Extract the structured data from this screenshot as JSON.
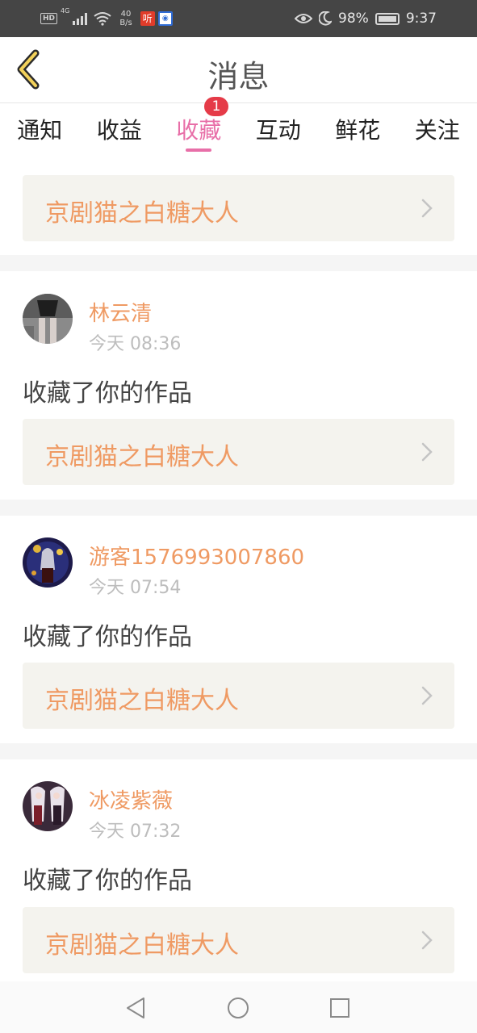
{
  "status_bar": {
    "hd": "HD",
    "net": "4G",
    "speed_value": "40",
    "speed_unit": "B/s",
    "app_ting": "听",
    "battery": "98%",
    "time": "9:37"
  },
  "header": {
    "title": "消息"
  },
  "tabs": [
    {
      "label": "通知"
    },
    {
      "label": "收益"
    },
    {
      "label": "收藏",
      "badge": "1"
    },
    {
      "label": "互动"
    },
    {
      "label": "鲜花"
    },
    {
      "label": "关注"
    }
  ],
  "top_work": {
    "title": "京剧猫之白糖大人"
  },
  "messages": [
    {
      "user": "林云清",
      "time": "今天 08:36",
      "text": "收藏了你的作品",
      "work": "京剧猫之白糖大人"
    },
    {
      "user": "游客1576993007860",
      "time": "今天 07:54",
      "text": "收藏了你的作品",
      "work": "京剧猫之白糖大人"
    },
    {
      "user": "冰凌紫薇",
      "time": "今天 07:32",
      "text": "收藏了你的作品",
      "work": "京剧猫之白糖大人"
    }
  ],
  "colors": {
    "accent_pink": "#e86fa8",
    "orange_text": "#ef9a63",
    "badge_red": "#e53b48",
    "card_bg": "#f4f3ee"
  }
}
